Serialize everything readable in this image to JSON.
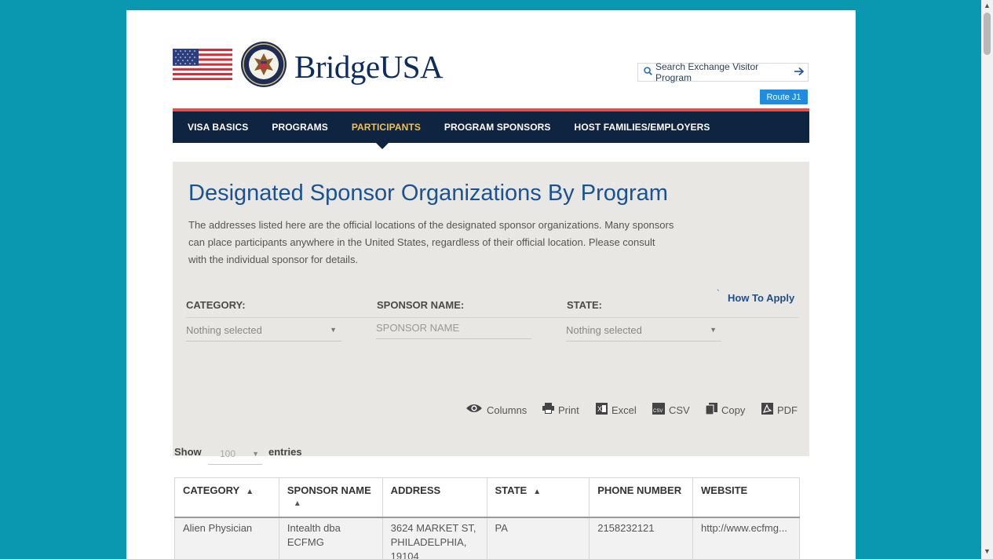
{
  "header": {
    "brand": "BridgeUSA",
    "search_label": "Search Exchange Visitor Program",
    "route_button": "Route J1"
  },
  "nav": {
    "items": [
      {
        "label": "VISA BASICS"
      },
      {
        "label": "PROGRAMS"
      },
      {
        "label": "PARTICIPANTS"
      },
      {
        "label": "PROGRAM SPONSORS"
      },
      {
        "label": "HOST FAMILIES/EMPLOYERS"
      }
    ],
    "active": "PARTICIPANTS"
  },
  "hero": {
    "title": "Designated Sponsor Organizations By Program",
    "description": "The addresses listed here are the official locations of the designated sponsor organizations. Many sponsors can place participants anywhere in the United States, regardless of their official location. Please consult with the individual sponsor for details."
  },
  "filters": {
    "how_to_apply": "How To Apply",
    "category_label": "CATEGORY:",
    "category_value": "Nothing selected",
    "sponsor_label": "SPONSOR NAME:",
    "sponsor_placeholder": "SPONSOR NAME",
    "state_label": "STATE:",
    "state_value": "Nothing selected"
  },
  "toolbar": {
    "columns": "Columns",
    "print": "Print",
    "excel": "Excel",
    "csv": "CSV",
    "copy": "Copy",
    "pdf": "PDF"
  },
  "entries": {
    "show": "Show",
    "value": "100",
    "suffix": "entries"
  },
  "table": {
    "headers": [
      "CATEGORY",
      "SPONSOR NAME",
      "ADDRESS",
      "STATE",
      "PHONE NUMBER",
      "WEBSITE"
    ],
    "rows": [
      {
        "category": "Alien Physician",
        "sponsor": "Intealth dba ECFMG",
        "address": "3624 MARKET ST, PHILADELPHIA, 19104",
        "state": "PA",
        "phone": "2158232121",
        "website": "http://www.ecfmg..."
      }
    ]
  },
  "colors": {
    "background": "#0a98b0",
    "nav": "#0f2440",
    "accent_red": "#e0504c",
    "active_nav": "#f2c14e",
    "title_blue": "#1a5394",
    "button_blue": "#1f8ce0"
  }
}
